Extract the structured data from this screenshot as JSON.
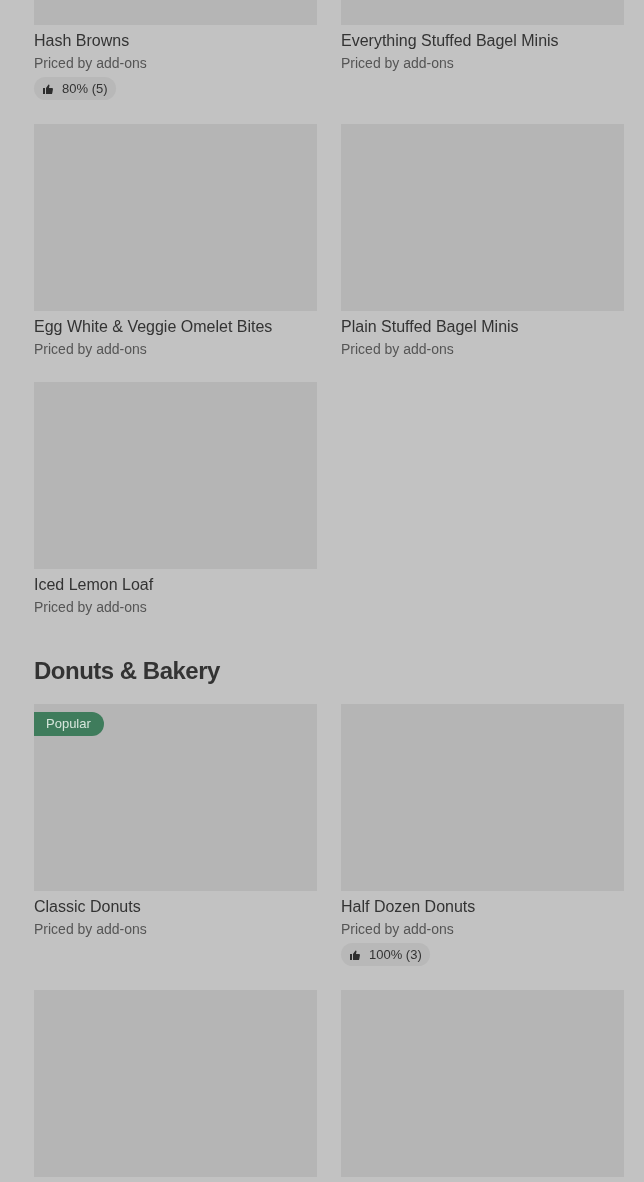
{
  "sections": [
    {
      "items": [
        {
          "kind": "product",
          "name": "Hash Browns",
          "subtitle": "Priced by add-ons",
          "rating": "80% (5)"
        },
        {
          "kind": "product",
          "name": "Everything Stuffed Bagel Minis",
          "subtitle": "Priced by add-ons"
        },
        {
          "kind": "product",
          "name": "Egg White & Veggie Omelet Bites",
          "subtitle": "Priced by add-ons"
        },
        {
          "kind": "product",
          "name": "Plain Stuffed Bagel Minis",
          "subtitle": "Priced by add-ons"
        },
        {
          "kind": "product",
          "name": "Iced Lemon Loaf",
          "subtitle": "Priced by add-ons"
        }
      ]
    },
    {
      "heading": "Donuts & Bakery",
      "items": [
        {
          "kind": "product",
          "name": "Classic Donuts",
          "subtitle": "Priced by add-ons",
          "badge": "Popular"
        },
        {
          "kind": "product",
          "name": "Half Dozen Donuts",
          "subtitle": "Priced by add-ons",
          "rating": "100% (3)"
        },
        {
          "kind": "image_only"
        },
        {
          "kind": "image_only"
        }
      ]
    }
  ]
}
